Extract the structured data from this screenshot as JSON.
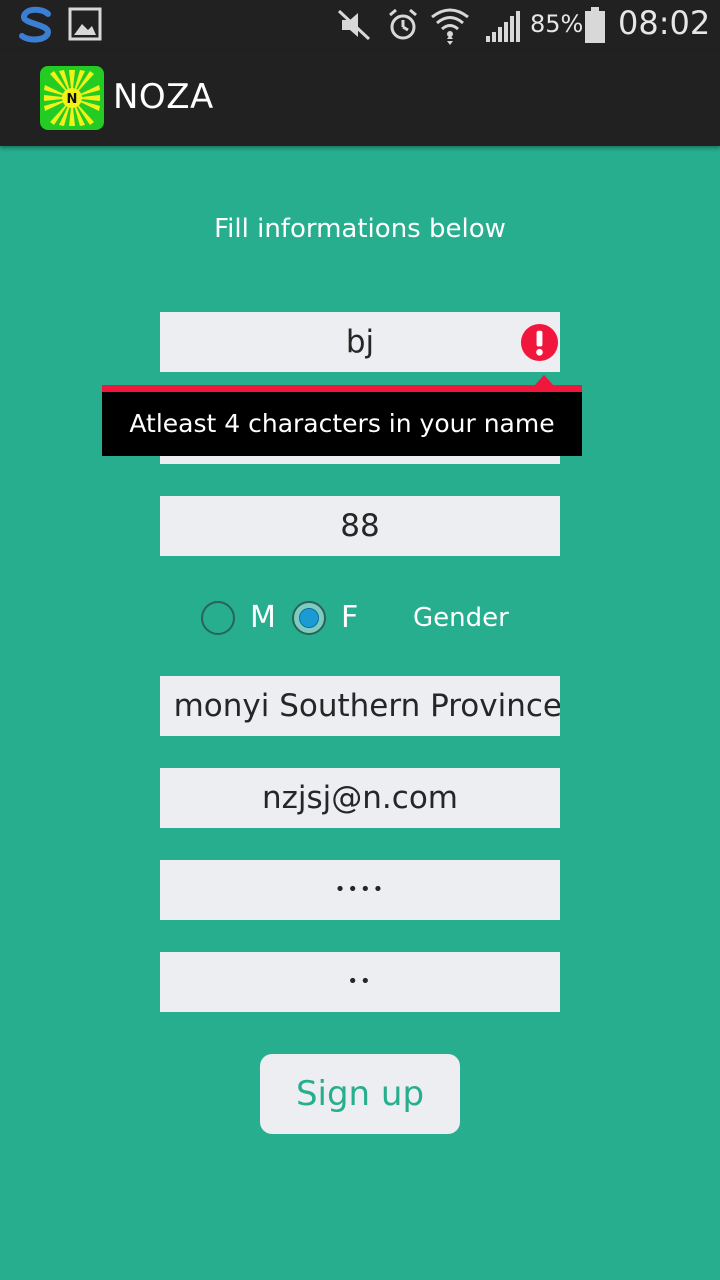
{
  "status_bar": {
    "battery_percent": "85%",
    "time": "08:02",
    "icons": [
      "s-app-icon",
      "gallery-icon",
      "mute-icon",
      "alarm-icon",
      "wifi-icon",
      "signal-icon",
      "battery-icon"
    ]
  },
  "action_bar": {
    "title": "NOZA",
    "logo_letter": "N"
  },
  "form": {
    "heading": "Fill informations below",
    "name_value": "bj",
    "name_error": "Atleast 4 characters in your name",
    "age_value": "88",
    "gender": {
      "option_m": "M",
      "option_f": "F",
      "selected": "F",
      "label": "Gender"
    },
    "address_value": "monyi Southern Province",
    "email_value": "nzjsj@n.com",
    "password_value": "••••",
    "confirm_password_value": "••",
    "signup_label": "Sign up"
  },
  "colors": {
    "background": "#26ae8f",
    "bar": "#212121",
    "field": "#eceef1",
    "error": "#f0163c"
  }
}
